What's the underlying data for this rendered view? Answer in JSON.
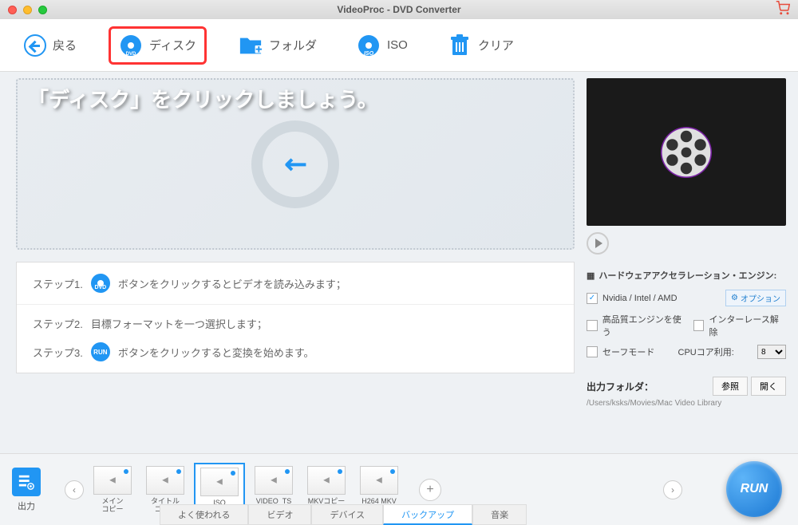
{
  "title": "VideoProc - DVD Converter",
  "annotation": "「ディスク」をクリックしましょう。",
  "toolbar": {
    "back": "戻る",
    "disc": "ディスク",
    "folder": "フォルダ",
    "iso": "ISO",
    "clear": "クリア"
  },
  "steps": {
    "step1_label": "ステップ1.",
    "step1_text": "ボタンをクリックするとビデオを読み込みます；",
    "step2_label": "ステップ2.",
    "step2_text": "目標フォーマットを一つ選択します；",
    "step3_label": "ステップ3.",
    "step3_icon_text": "RUN",
    "step3_text": "ボタンをクリックすると変換を始めます。",
    "dvd_icon_text": "DVD"
  },
  "hw": {
    "title": "ハードウェアアクセラレーション・エンジン:",
    "gpu": "Nvidia / Intel / AMD",
    "option": "オプション",
    "hq": "高品質エンジンを使う",
    "deint": "インターレース解除",
    "safe": "セーフモード",
    "cpu_label": "CPUコア利用:",
    "cpu_value": "8"
  },
  "output": {
    "label": "出力フォルダ：",
    "browse": "参照",
    "open": "開く",
    "path": "/Users/ksks/Movies/Mac Video Library"
  },
  "bottom": {
    "output_label": "出力",
    "formats": [
      "メイン\nコピー",
      "タイトル\nコピー",
      "ISO",
      "VIDEO_TS",
      "MKVコピー",
      "H264 MKV"
    ],
    "selected_index": 2
  },
  "tabs": [
    "よく使われる",
    "ビデオ",
    "デバイス",
    "バックアップ",
    "音楽"
  ],
  "active_tab": 3,
  "run": "RUN"
}
